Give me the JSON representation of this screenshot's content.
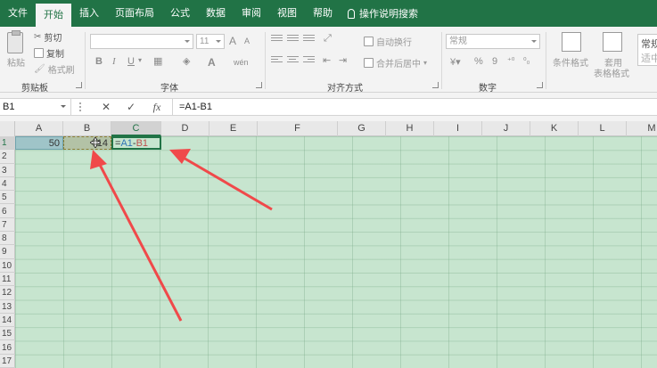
{
  "menu": {
    "tabs": [
      "文件",
      "开始",
      "插入",
      "页面布局",
      "公式",
      "数据",
      "审阅",
      "视图",
      "帮助"
    ],
    "search_label": "操作说明搜索"
  },
  "ribbon": {
    "clipboard": {
      "paste": "粘贴",
      "cut": "剪切",
      "copy": "复制",
      "format_painter": "格式刷",
      "label": "剪贴板"
    },
    "font": {
      "size": "11",
      "bold": "B",
      "italic": "I",
      "underline": "U",
      "grow": "A",
      "shrink": "A",
      "color_a": "A",
      "wen": "wén",
      "label": "字体"
    },
    "alignment": {
      "wrap_text": "自动换行",
      "merge_center": "合并后居中",
      "label": "对齐方式"
    },
    "number": {
      "format": "常规",
      "percent": "%",
      "comma": "9",
      "label": "数字"
    },
    "styles": {
      "conditional": "条件格式",
      "table_line1": "套用",
      "table_line2": "表格格式",
      "style_1": "常规",
      "style_2": "适中"
    }
  },
  "formula_bar": {
    "name_box": "B1",
    "cancel": "✕",
    "enter": "✓",
    "fx": "fx",
    "formula": "=A1-B1"
  },
  "grid": {
    "columns": [
      "A",
      "B",
      "C",
      "D",
      "E",
      "F",
      "G",
      "H",
      "I",
      "J",
      "K",
      "L",
      "M"
    ],
    "rows": [
      "1",
      "2",
      "3",
      "4",
      "5",
      "6",
      "7",
      "8",
      "9",
      "10",
      "11",
      "12",
      "13",
      "14",
      "15",
      "16",
      "17"
    ],
    "a1": "50",
    "b1": "14",
    "c1_prefix": "=",
    "c1_ref_a": "A1",
    "c1_minus": "-",
    "c1_ref_b": "B1"
  },
  "colors": {
    "accent": "#217346",
    "ref_a": "#2f74b5",
    "ref_b": "#c0504d",
    "arrow": "#f0494a"
  }
}
